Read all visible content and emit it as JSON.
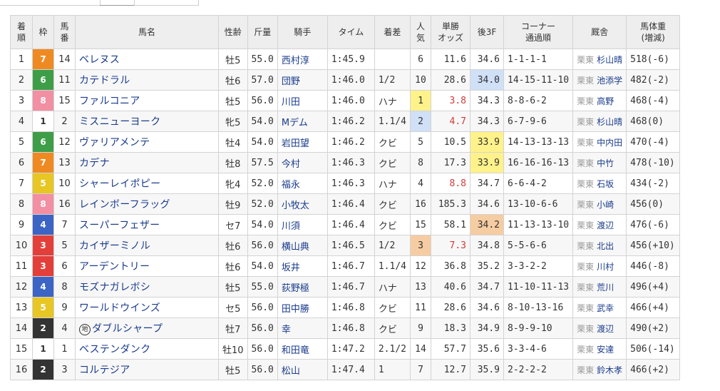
{
  "headers": {
    "rank": "着\n順",
    "waku": "枠",
    "umaban": "馬\n番",
    "horse": "馬名",
    "sex_age": "性齢",
    "weight": "斤量",
    "jockey": "騎手",
    "time": "タイム",
    "margin": "着差",
    "popularity": "人\n気",
    "odds": "単勝\nオッズ",
    "last3f": "後3F",
    "corner": "コーナー\n通過順",
    "stable": "厩舎",
    "body_weight": "馬体重\n(増減)"
  },
  "colors": {
    "link": "#1a3c8c",
    "header_bg": "#eeeeee",
    "waku_1": "#ffffff",
    "waku_2": "#333333",
    "waku_3": "#e33f3a",
    "waku_4": "#3b64c4",
    "waku_5": "#e8c623",
    "waku_6": "#3e9e48",
    "waku_7": "#ef8a23",
    "waku_8": "#f28fa2",
    "first_highlight": "#fff28a",
    "second_highlight": "#cfe0f7",
    "third_highlight": "#f6cca2"
  },
  "rows": [
    {
      "rank": "1",
      "waku": "7",
      "umaban": "14",
      "local_mark": "",
      "horse": "ベレヌス",
      "sex_age": "牡5",
      "weight": "55.0",
      "jockey": "西村淳",
      "time": "1:45.9",
      "margin": "",
      "popularity": "6",
      "odds": "11.6",
      "last3f": "34.6",
      "corner": "1-1-1-1",
      "stable_loc": "栗東",
      "trainer": "杉山晴",
      "body_weight": "518(-6)"
    },
    {
      "rank": "2",
      "waku": "6",
      "umaban": "11",
      "local_mark": "",
      "horse": "カテドラル",
      "sex_age": "牡6",
      "weight": "57.0",
      "jockey": "団野",
      "time": "1:46.0",
      "margin": "1/2",
      "popularity": "10",
      "odds": "28.6",
      "last3f": "34.0",
      "corner": "14-15-11-10",
      "stable_loc": "栗東",
      "trainer": "池添学",
      "body_weight": "482(-2)"
    },
    {
      "rank": "3",
      "waku": "8",
      "umaban": "15",
      "local_mark": "",
      "horse": "ファルコニア",
      "sex_age": "牡5",
      "weight": "56.0",
      "jockey": "川田",
      "time": "1:46.0",
      "margin": "ハナ",
      "popularity": "1",
      "odds": "3.8",
      "last3f": "34.3",
      "corner": "8-8-6-2",
      "stable_loc": "栗東",
      "trainer": "高野",
      "body_weight": "468(-4)"
    },
    {
      "rank": "4",
      "waku": "1",
      "umaban": "2",
      "local_mark": "",
      "horse": "ミスニューヨーク",
      "sex_age": "牝5",
      "weight": "54.0",
      "jockey": "Mデム",
      "time": "1:46.2",
      "margin": "1.1/4",
      "popularity": "2",
      "odds": "4.7",
      "last3f": "34.3",
      "corner": "6-7-9-6",
      "stable_loc": "栗東",
      "trainer": "杉山晴",
      "body_weight": "468(0)"
    },
    {
      "rank": "5",
      "waku": "6",
      "umaban": "12",
      "local_mark": "",
      "horse": "ヴァリアメンテ",
      "sex_age": "牡4",
      "weight": "54.0",
      "jockey": "岩田望",
      "time": "1:46.2",
      "margin": "クビ",
      "popularity": "5",
      "odds": "10.5",
      "last3f": "33.9",
      "corner": "14-13-13-13",
      "stable_loc": "栗東",
      "trainer": "中内田",
      "body_weight": "470(-4)"
    },
    {
      "rank": "6",
      "waku": "7",
      "umaban": "13",
      "local_mark": "",
      "horse": "カデナ",
      "sex_age": "牡8",
      "weight": "57.5",
      "jockey": "今村",
      "time": "1:46.3",
      "margin": "クビ",
      "popularity": "8",
      "odds": "17.3",
      "last3f": "33.9",
      "corner": "16-16-16-13",
      "stable_loc": "栗東",
      "trainer": "中竹",
      "body_weight": "478(-10)"
    },
    {
      "rank": "7",
      "waku": "5",
      "umaban": "10",
      "local_mark": "",
      "horse": "シャーレイポピー",
      "sex_age": "牝4",
      "weight": "52.0",
      "jockey": "福永",
      "time": "1:46.3",
      "margin": "ハナ",
      "popularity": "4",
      "odds": "8.8",
      "last3f": "34.7",
      "corner": "6-6-4-2",
      "stable_loc": "栗東",
      "trainer": "石坂",
      "body_weight": "434(-2)"
    },
    {
      "rank": "8",
      "waku": "8",
      "umaban": "16",
      "local_mark": "",
      "horse": "レインボーフラッグ",
      "sex_age": "牡9",
      "weight": "52.0",
      "jockey": "小牧太",
      "time": "1:46.4",
      "margin": "クビ",
      "popularity": "16",
      "odds": "185.3",
      "last3f": "34.6",
      "corner": "13-10-6-6",
      "stable_loc": "栗東",
      "trainer": "小崎",
      "body_weight": "456(0)"
    },
    {
      "rank": "9",
      "waku": "4",
      "umaban": "7",
      "local_mark": "",
      "horse": "スーパーフェザー",
      "sex_age": "セ7",
      "weight": "54.0",
      "jockey": "川須",
      "time": "1:46.4",
      "margin": "クビ",
      "popularity": "15",
      "odds": "58.1",
      "last3f": "34.2",
      "corner": "11-13-13-10",
      "stable_loc": "栗東",
      "trainer": "渡辺",
      "body_weight": "476(-6)"
    },
    {
      "rank": "10",
      "waku": "3",
      "umaban": "5",
      "local_mark": "",
      "horse": "カイザーミノル",
      "sex_age": "牡6",
      "weight": "56.0",
      "jockey": "横山典",
      "time": "1:46.5",
      "margin": "1/2",
      "popularity": "3",
      "odds": "7.3",
      "last3f": "34.8",
      "corner": "5-5-6-6",
      "stable_loc": "栗東",
      "trainer": "北出",
      "body_weight": "456(+10)"
    },
    {
      "rank": "11",
      "waku": "3",
      "umaban": "6",
      "local_mark": "",
      "horse": "アーデントリー",
      "sex_age": "牡6",
      "weight": "54.0",
      "jockey": "坂井",
      "time": "1:46.7",
      "margin": "1.1/4",
      "popularity": "12",
      "odds": "36.8",
      "last3f": "35.2",
      "corner": "3-3-2-2",
      "stable_loc": "栗東",
      "trainer": "川村",
      "body_weight": "446(-8)"
    },
    {
      "rank": "12",
      "waku": "4",
      "umaban": "8",
      "local_mark": "",
      "horse": "モズナガレボシ",
      "sex_age": "牡5",
      "weight": "55.0",
      "jockey": "荻野極",
      "time": "1:46.7",
      "margin": "ハナ",
      "popularity": "13",
      "odds": "40.6",
      "last3f": "34.7",
      "corner": "11-10-11-13",
      "stable_loc": "栗東",
      "trainer": "荒川",
      "body_weight": "496(+4)"
    },
    {
      "rank": "13",
      "waku": "5",
      "umaban": "9",
      "local_mark": "",
      "horse": "ワールドウインズ",
      "sex_age": "セ5",
      "weight": "56.0",
      "jockey": "田中勝",
      "time": "1:46.8",
      "margin": "クビ",
      "popularity": "11",
      "odds": "28.6",
      "last3f": "34.6",
      "corner": "8-10-13-16",
      "stable_loc": "栗東",
      "trainer": "武幸",
      "body_weight": "466(+4)"
    },
    {
      "rank": "14",
      "waku": "2",
      "umaban": "4",
      "local_mark": "地",
      "horse": "ダブルシャープ",
      "sex_age": "牡7",
      "weight": "56.0",
      "jockey": "幸",
      "time": "1:46.8",
      "margin": "クビ",
      "popularity": "9",
      "odds": "18.3",
      "last3f": "34.9",
      "corner": "8-9-9-10",
      "stable_loc": "栗東",
      "trainer": "渡辺",
      "body_weight": "490(+2)"
    },
    {
      "rank": "15",
      "waku": "1",
      "umaban": "1",
      "local_mark": "",
      "horse": "ベステンダンク",
      "sex_age": "牡10",
      "weight": "56.0",
      "jockey": "和田竜",
      "time": "1:47.2",
      "margin": "2.1/2",
      "popularity": "14",
      "odds": "57.7",
      "last3f": "35.6",
      "corner": "3-3-4-6",
      "stable_loc": "栗東",
      "trainer": "安達",
      "body_weight": "506(-14)"
    },
    {
      "rank": "16",
      "waku": "2",
      "umaban": "3",
      "local_mark": "",
      "horse": "コルテジア",
      "sex_age": "牡5",
      "weight": "56.0",
      "jockey": "松山",
      "time": "1:47.4",
      "margin": "1",
      "popularity": "7",
      "odds": "12.7",
      "last3f": "35.9",
      "corner": "2-2-2-2",
      "stable_loc": "栗東",
      "trainer": "鈴木孝",
      "body_weight": "466(+2)"
    }
  ]
}
